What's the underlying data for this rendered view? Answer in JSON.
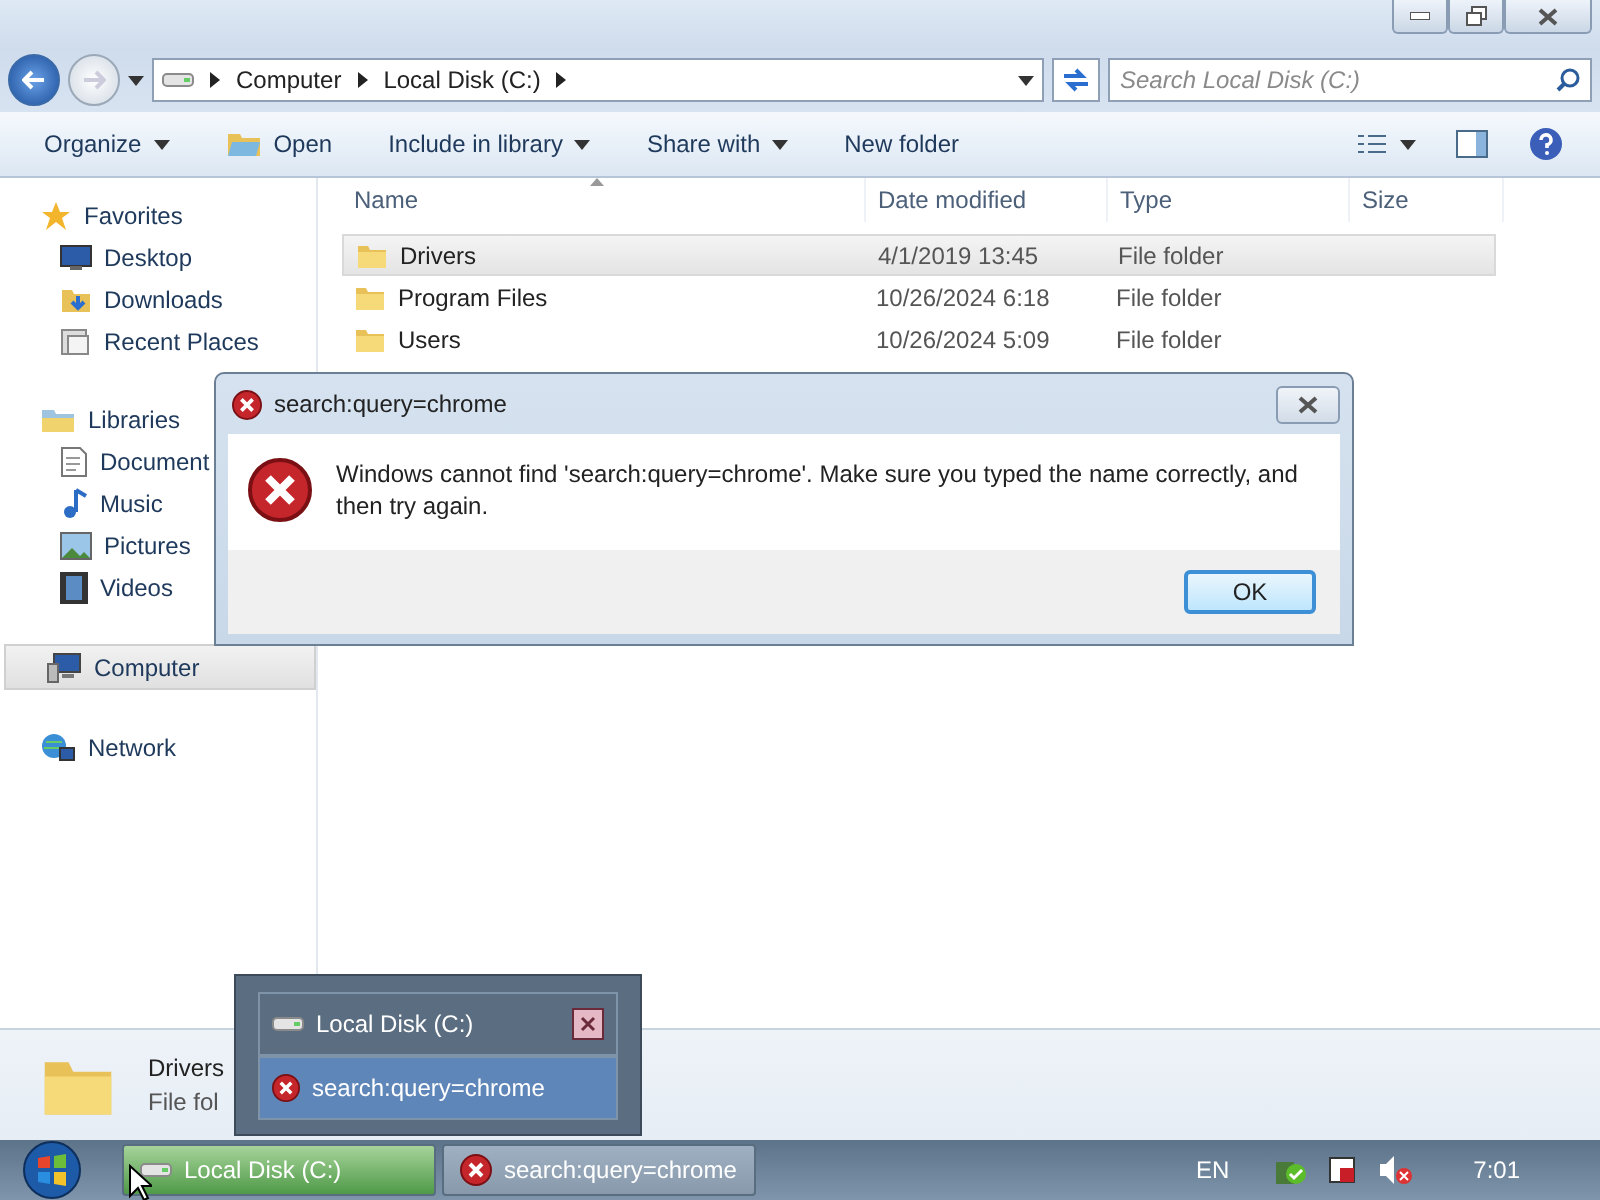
{
  "address": {
    "crumbs": [
      "Computer",
      "Local Disk (C:)"
    ]
  },
  "search": {
    "placeholder": "Search Local Disk (C:)"
  },
  "toolbar": {
    "items": [
      {
        "label": "Organize",
        "kind": "dropdown"
      },
      {
        "label": "Open",
        "kind": "with-icon"
      },
      {
        "label": "Include in library",
        "kind": "dropdown"
      },
      {
        "label": "Share with",
        "kind": "dropdown"
      },
      {
        "label": "New folder",
        "kind": "plain"
      }
    ]
  },
  "sidebar": {
    "groups": [
      {
        "label": "Favorites",
        "selected": false,
        "children": [
          {
            "label": "Desktop",
            "selected": false
          },
          {
            "label": "Downloads",
            "selected": false
          },
          {
            "label": "Recent Places",
            "selected": false
          }
        ]
      },
      {
        "label": "Libraries",
        "selected": false,
        "children": [
          {
            "label": "Document",
            "selected": false
          },
          {
            "label": "Music",
            "selected": false
          },
          {
            "label": "Pictures",
            "selected": false
          },
          {
            "label": "Videos",
            "selected": false
          }
        ]
      },
      {
        "label": "Computer",
        "selected": true
      },
      {
        "label": "Network",
        "selected": false
      }
    ]
  },
  "table": {
    "columns": [
      "Name",
      "Date modified",
      "Type",
      "Size"
    ],
    "rows": [
      {
        "name": "Drivers",
        "date": "4/1/2019 13:45",
        "type": "File folder",
        "selected": true
      },
      {
        "name": "Program Files",
        "date": "10/26/2024 6:18",
        "type": "File folder",
        "selected": false
      },
      {
        "name": "Users",
        "date": "10/26/2024 5:09",
        "type": "File folder",
        "selected": false
      }
    ]
  },
  "details": {
    "name": "Drivers",
    "type": "File fol"
  },
  "dialog": {
    "title": "search:query=chrome",
    "message": "Windows cannot find 'search:query=chrome'. Make sure you typed the name correctly, and then try again.",
    "button": "OK"
  },
  "thumbnail_popup": {
    "items": [
      {
        "label": "Local Disk (C:)",
        "kind": "drive",
        "selected": false
      },
      {
        "label": "search:query=chrome",
        "kind": "error",
        "selected": true
      }
    ]
  },
  "taskbar": {
    "buttons": [
      {
        "label": "Local Disk (C:)",
        "kind": "drive",
        "selected": true
      },
      {
        "label": "search:query=chrome",
        "kind": "error",
        "selected": false
      }
    ],
    "language": "EN",
    "clock": "7:01"
  }
}
